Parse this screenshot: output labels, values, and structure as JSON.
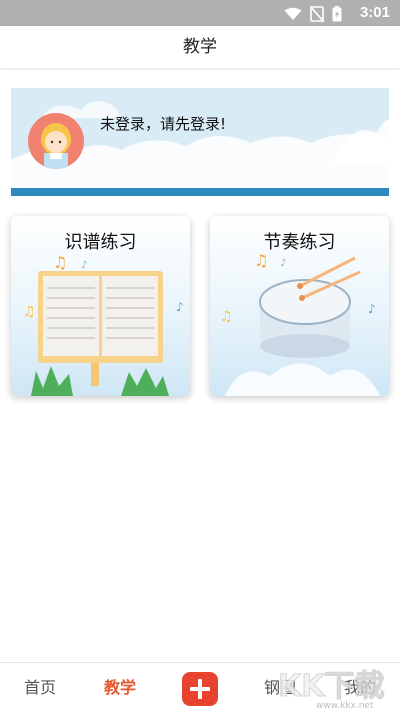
{
  "status_bar": {
    "time": "3:01",
    "icons": [
      "wifi-icon",
      "no-sim-icon",
      "battery-charging-icon"
    ]
  },
  "header": {
    "title": "教学"
  },
  "banner": {
    "login_prompt": "未登录，请先登录!"
  },
  "cards": [
    {
      "title": "识谱练习",
      "illustration": "sheet-music-stand"
    },
    {
      "title": "节奏练习",
      "illustration": "drum-with-sticks"
    }
  ],
  "tab_bar": {
    "home": "首页",
    "teach": "教学",
    "add_icon": "plus-icon",
    "piano_circle": "钢圈",
    "mine": "我的",
    "active": "teach"
  },
  "watermark": {
    "text": "KK下载",
    "url": "www.kkx.net"
  },
  "colors": {
    "accent": "#e8572f",
    "add_button": "#e8432f",
    "banner_stripe": "#2e8bc0",
    "status_bar": "#b0b0b0"
  }
}
